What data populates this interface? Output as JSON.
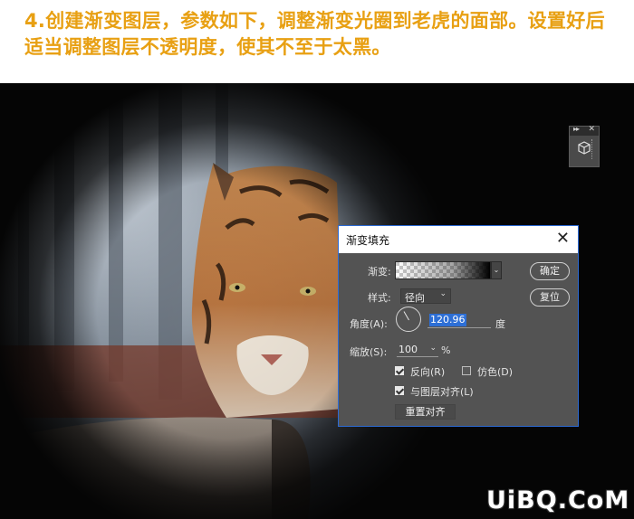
{
  "instruction": {
    "text": "4.创建渐变图层，参数如下，调整渐变光圈到老虎的面部。设置好后适当调整图层不透明度，使其不至于太黑。",
    "color": "#e8a013"
  },
  "mini_panel": {
    "collapse_icon": "double-arrow-icon",
    "close_icon": "close-icon",
    "tool_icon": "3d-cube-icon"
  },
  "dialog": {
    "title": "渐变填充",
    "close_glyph": "✕",
    "gradient_label": "渐变:",
    "style_label": "样式:",
    "style_value": "径向",
    "angle_label": "角度(A):",
    "angle_value": "120.96",
    "angle_unit": "度",
    "scale_label": "缩放(S):",
    "scale_value": "100",
    "scale_unit": "%",
    "reverse_label": "反向(R)",
    "reverse_checked": true,
    "dither_label": "仿色(D)",
    "dither_checked": false,
    "align_label": "与图层对齐(L)",
    "align_checked": true,
    "realign_button": "重置对齐",
    "ok_button": "确定",
    "reset_button": "复位",
    "accent_color": "#2c6bd6"
  },
  "watermark": {
    "text": "UiBQ.CoM"
  }
}
